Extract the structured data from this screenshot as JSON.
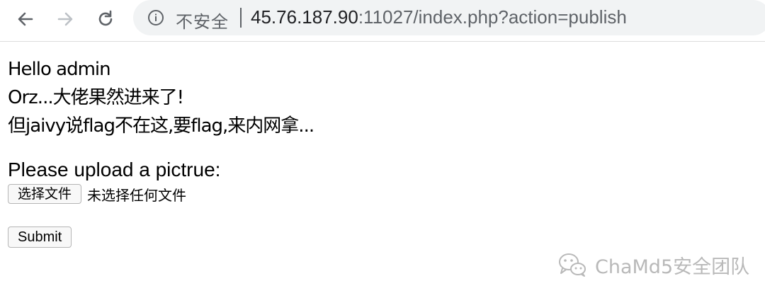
{
  "browser": {
    "security_label": "不安全",
    "url_host": "45.76.187.90",
    "url_rest": ":11027/index.php?action=publish",
    "icons": {
      "back": "back-arrow-icon",
      "forward": "forward-arrow-icon",
      "reload": "reload-icon",
      "info": "info-circle-icon"
    }
  },
  "page": {
    "greeting": "Hello admin",
    "line2": "Orz...大佬果然进来了!",
    "line3": "但jaivy说flag不在这,要flag,来内网拿...",
    "upload_prompt": "Please upload a pictrue:",
    "file_button": "选择文件",
    "file_status": "未选择任何文件",
    "submit_label": "Submit"
  },
  "watermark": {
    "text": "ChaMd5安全团队",
    "icon": "wechat-icon"
  },
  "colors": {
    "omnibox_bg": "#f1f3f4",
    "url_host": "#202124",
    "url_rest": "#5f6368",
    "watermark": "#b9b9b9"
  }
}
